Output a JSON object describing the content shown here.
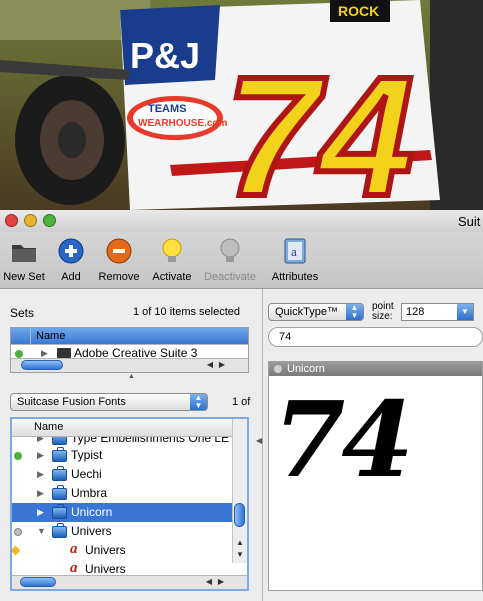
{
  "window": {
    "title": "Suit"
  },
  "toolbar": {
    "items": [
      {
        "label": "New Set",
        "icon": "folder-icon"
      },
      {
        "label": "Add",
        "icon": "plus-icon"
      },
      {
        "label": "Remove",
        "icon": "minus-icon"
      },
      {
        "label": "Activate",
        "icon": "lightbulb-on-icon"
      },
      {
        "label": "Deactivate",
        "icon": "lightbulb-off-icon"
      },
      {
        "label": "Attributes",
        "icon": "attributes-book-icon"
      }
    ]
  },
  "photo": {
    "decal_line1": "P&J",
    "decal_line2": "TEAMS",
    "decal_line3": "WEARHOUSE.com",
    "number": "74",
    "top_banner": "ROCK"
  },
  "sets": {
    "label": "Sets",
    "count_text": "1 of 10 items selected",
    "column_header": "Name",
    "rows": [
      {
        "label": "Adobe Creative Suite 3",
        "status_color": "#4caf3a"
      }
    ]
  },
  "library": {
    "selected": "Suitcase Fusion Fonts",
    "count_text": "1 of",
    "column_header": "Name",
    "rows": [
      {
        "label": "Type Embellishments One LE",
        "type": "suitcase",
        "status": "green",
        "expanded": false
      },
      {
        "label": "Typist",
        "type": "suitcase",
        "status": "green",
        "expanded": false
      },
      {
        "label": "Uechi",
        "type": "suitcase",
        "status": "none",
        "expanded": false
      },
      {
        "label": "Umbra",
        "type": "suitcase",
        "status": "none",
        "expanded": false
      },
      {
        "label": "Unicorn",
        "type": "suitcase",
        "status": "none",
        "expanded": false,
        "selected": true
      },
      {
        "label": "Univers",
        "type": "suitcase",
        "status": "gray",
        "expanded": true
      },
      {
        "label": "Univers",
        "type": "font",
        "status": "diamond"
      },
      {
        "label": "Univers",
        "type": "font",
        "status": "none"
      }
    ]
  },
  "preview": {
    "mode": "QuickType™",
    "point_size_label_1": "point",
    "point_size_label_2": "size:",
    "point_size": "128",
    "sample_text": "74",
    "font_name": "Unicorn",
    "rendered_text": "74"
  },
  "colors": {
    "selection": "#3875d7",
    "accent_blue": "#2f72d4"
  }
}
